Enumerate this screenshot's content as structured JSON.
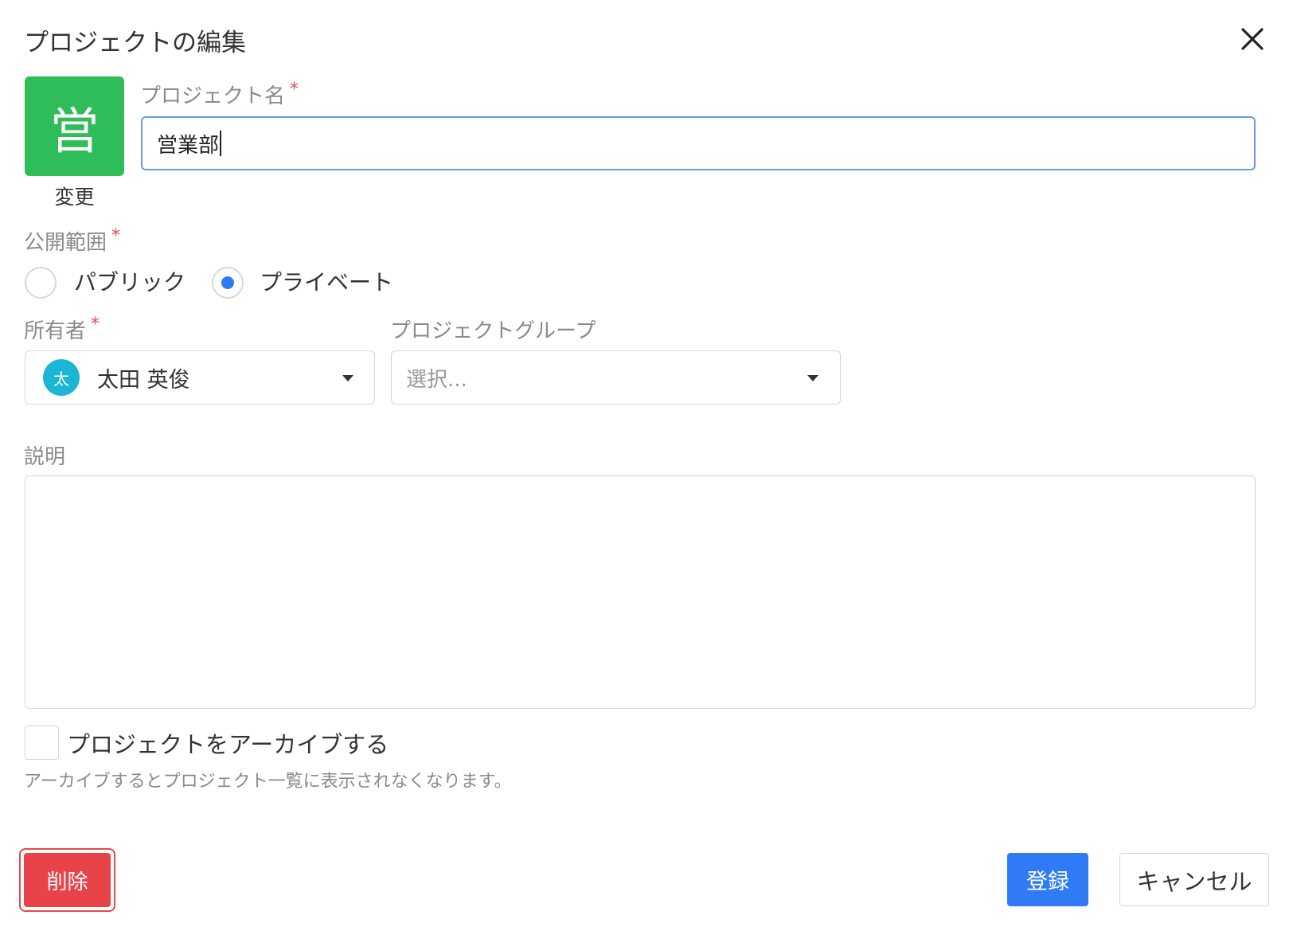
{
  "dialog": {
    "title": "プロジェクトの編集",
    "close_icon": "close-icon"
  },
  "project_icon": {
    "char": "営",
    "change_label": "変更",
    "color": "#2ebd59"
  },
  "project_name": {
    "label": "プロジェクト名",
    "required_mark": "*",
    "value": "営業部"
  },
  "visibility": {
    "label": "公開範囲",
    "required_mark": "*",
    "options": [
      {
        "label": "パブリック",
        "selected": false
      },
      {
        "label": "プライベート",
        "selected": true
      }
    ]
  },
  "owner": {
    "label": "所有者",
    "required_mark": "*",
    "avatar_char": "太",
    "name": "太田 英俊"
  },
  "project_group": {
    "label": "プロジェクトグループ",
    "placeholder": "選択..."
  },
  "description": {
    "label": "説明",
    "value": ""
  },
  "archive": {
    "label": "プロジェクトをアーカイブする",
    "help": "アーカイブするとプロジェクト一覧に表示されなくなります。",
    "checked": false
  },
  "buttons": {
    "delete": "削除",
    "save": "登録",
    "cancel": "キャンセル"
  },
  "colors": {
    "primary": "#2f7bf5",
    "danger": "#e9434a",
    "required": "#e5484d",
    "avatar": "#1bb5d6"
  }
}
